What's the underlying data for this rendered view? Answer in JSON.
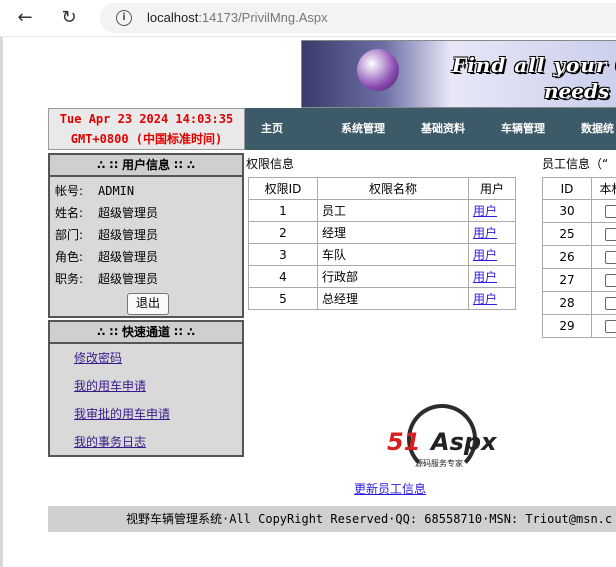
{
  "browser": {
    "url_host": "localhost",
    "url_rest": ":14173/PrivilMng.Aspx"
  },
  "banner": {
    "line1": "Find all your C",
    "line2": "needs"
  },
  "clock": {
    "line1": "Tue Apr 23 2024 14:03:35",
    "line2": "GMT+0800 (中国标准时间)"
  },
  "nav": {
    "items": [
      "主页",
      "系统管理",
      "基础资料",
      "车辆管理",
      "数据统"
    ]
  },
  "user_panel": {
    "title": "∴ ∷ 用户信息 ∷ ∴",
    "rows": [
      {
        "label": "帐号:",
        "value": "ADMIN"
      },
      {
        "label": "姓名:",
        "value": "超级管理员"
      },
      {
        "label": "部门:",
        "value": "超级管理员"
      },
      {
        "label": "角色:",
        "value": "超级管理员"
      },
      {
        "label": "职务:",
        "value": "超级管理员"
      }
    ],
    "logout": "退出"
  },
  "quick_panel": {
    "title": "∴ ∷ 快速通道 ∷ ∴",
    "links": [
      "修改密码",
      "我的用车申请",
      "我审批的用车申请",
      "我的事务日志"
    ]
  },
  "privileges": {
    "title": "权限信息",
    "headers": [
      "权限ID",
      "权限名称",
      "用户"
    ],
    "rows": [
      {
        "id": "1",
        "name": "员工",
        "link": "用户"
      },
      {
        "id": "2",
        "name": "经理",
        "link": "用户"
      },
      {
        "id": "3",
        "name": "车队",
        "link": "用户"
      },
      {
        "id": "4",
        "name": "行政部",
        "link": "用户"
      },
      {
        "id": "5",
        "name": "总经理",
        "link": "用户"
      }
    ]
  },
  "employees": {
    "title": "员工信息（“",
    "headers": [
      "ID",
      "本权"
    ],
    "ids": [
      "30",
      "25",
      "26",
      "27",
      "28",
      "29"
    ]
  },
  "logo": {
    "brand_red": "51",
    "brand_black": "Aspx",
    "tagline": "源码服务专家"
  },
  "update_link": "更新员工信息",
  "footer": "视野车辆管理系统·All CopyRight Reserved·QQ: 68558710·MSN: Triout@msn.c",
  "colors": {
    "nav_bg": "#3d5a69",
    "clock_text": "#e00000",
    "link": "#2a1adf"
  }
}
